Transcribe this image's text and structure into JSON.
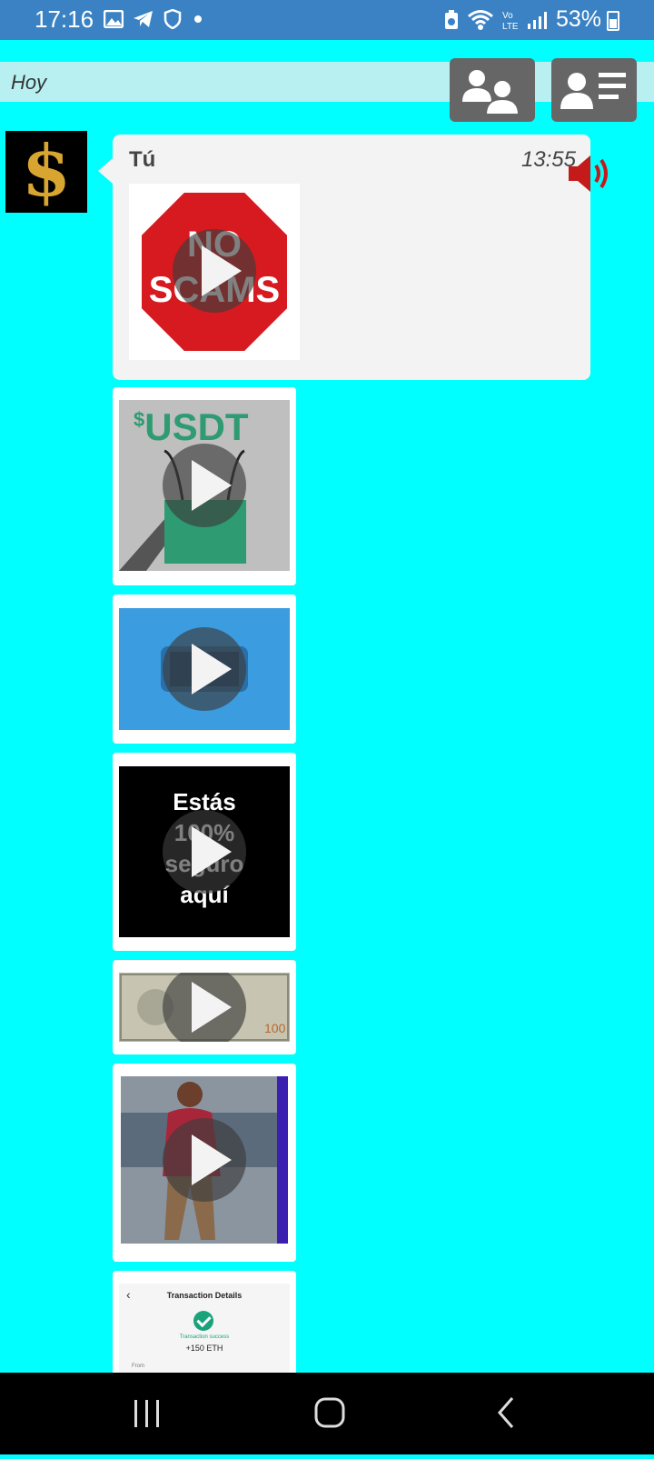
{
  "status_bar": {
    "time": "17:16",
    "battery_percent": "53%",
    "network": "LTE",
    "signal_label": "Vo"
  },
  "day_header": {
    "label": "Hoy"
  },
  "message": {
    "sender": "Tú",
    "time": "13:55"
  },
  "media": [
    {
      "kind": "video",
      "icon": "stop-sign",
      "caption_lines": [
        "NO",
        "SCAMS"
      ]
    },
    {
      "kind": "video",
      "caption": "USDT",
      "caption_prefix": "$"
    },
    {
      "kind": "video",
      "icon": "phone"
    },
    {
      "kind": "video",
      "caption_lines": [
        "Estás",
        "100%",
        "seguro",
        "aquí"
      ]
    },
    {
      "kind": "video",
      "icon": "banknote"
    },
    {
      "kind": "video",
      "icon": "person-photo"
    },
    {
      "kind": "image",
      "screen_title": "Transaction Details",
      "status": "Transaction success",
      "amount": "+150 ETH",
      "from_label": "From"
    }
  ],
  "colors": {
    "background": "#00ffff",
    "status_bar": "#3a82c4",
    "bubble": "#f3f3f3",
    "header_button": "#666666",
    "speaker": "#c41a1a"
  }
}
